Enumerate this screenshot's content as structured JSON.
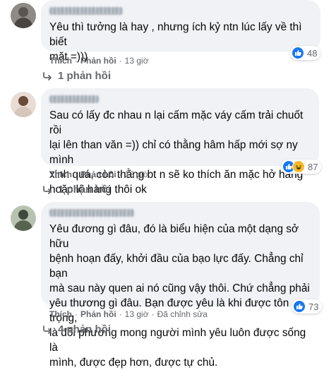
{
  "comments": [
    {
      "text": "Yêu thì tưởng là hay , nhưng ích kỷ ntn lúc lấy về thì biết\nmặt =)))",
      "actions": {
        "like": "Thích",
        "reply": "Phản hồi",
        "time": "13 giờ",
        "edited": ""
      },
      "reaction_count": "48",
      "reaction_icons": [
        "like-icon"
      ],
      "replies": "1 phản hồi"
    },
    {
      "text": "Sau có lấy đc nhau n lại cấm mặc váy cấm trải chuốt rồi\nlại lên than văn =)) chỉ có thằng hâm hấp mới sợ ny mình\nxinh quá, còn thằng bt n sẽ ko thích ăn mặc hở hang\nhoặc lộ hàng thôi ok",
      "actions": {
        "like": "Thích",
        "reply": "Phản hồi",
        "time": "13 giờ",
        "edited": ""
      },
      "reaction_count": "87",
      "reaction_icons": [
        "like-icon",
        "haha-icon"
      ],
      "replies": "1 phản hồi"
    },
    {
      "text": "Yêu đương gì đâu, đó là biểu hiện của một dạng sở hữu\nbệnh hoạn đấy, khởi đầu của bạo lực đấy. Chẳng chỉ bạn\nmà sau này quen ai nó cũng vậy thôi. Chứ chẳng phải\nyêu thương gì đâu. Bạn được yêu là khi được tôn trọng,\nlà đối phương mong người mình yêu luôn được sống là\nmình, được đẹp hơn, được tự chủ.",
      "actions": {
        "like": "Thích",
        "reply": "Phản hồi",
        "time": "13 giờ",
        "edited": "Đã chỉnh sửa"
      },
      "reaction_count": "73",
      "reaction_icons": [
        "like-icon"
      ],
      "replies": "4 phản hồi"
    }
  ],
  "colors": {
    "bubble": "#f0f2f5",
    "like": "#1877f2",
    "muted": "#65676b"
  }
}
